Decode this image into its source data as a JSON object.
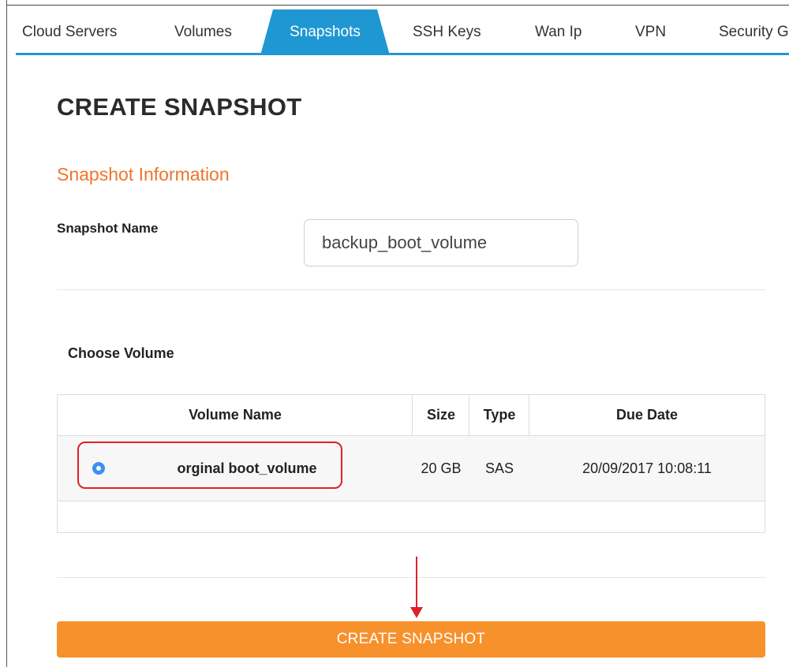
{
  "tabs": [
    {
      "label": "Cloud Servers",
      "active": false
    },
    {
      "label": "Volumes",
      "active": false
    },
    {
      "label": "Snapshots",
      "active": true
    },
    {
      "label": "SSH Keys",
      "active": false
    },
    {
      "label": "Wan Ip",
      "active": false
    },
    {
      "label": "VPN",
      "active": false
    },
    {
      "label": "Security G",
      "active": false
    }
  ],
  "page": {
    "title": "CREATE SNAPSHOT",
    "section_title": "Snapshot Information"
  },
  "form": {
    "snapshot_name_label": "Snapshot Name",
    "snapshot_name_value": "backup_boot_volume",
    "choose_volume_label": "Choose Volume"
  },
  "table": {
    "headers": [
      "Volume Name",
      "Size",
      "Type",
      "Due Date"
    ],
    "rows": [
      {
        "selected": true,
        "volume_name": "orginal boot_volume",
        "size": "20 GB",
        "type": "SAS",
        "due_date": "20/09/2017 10:08:11"
      }
    ]
  },
  "actions": {
    "create_label": "CREATE SNAPSHOT"
  },
  "colors": {
    "accent_blue": "#1f97d3",
    "orange": "#f7912c",
    "section_orange": "#f0742b",
    "annotation_red": "#e0202a"
  }
}
